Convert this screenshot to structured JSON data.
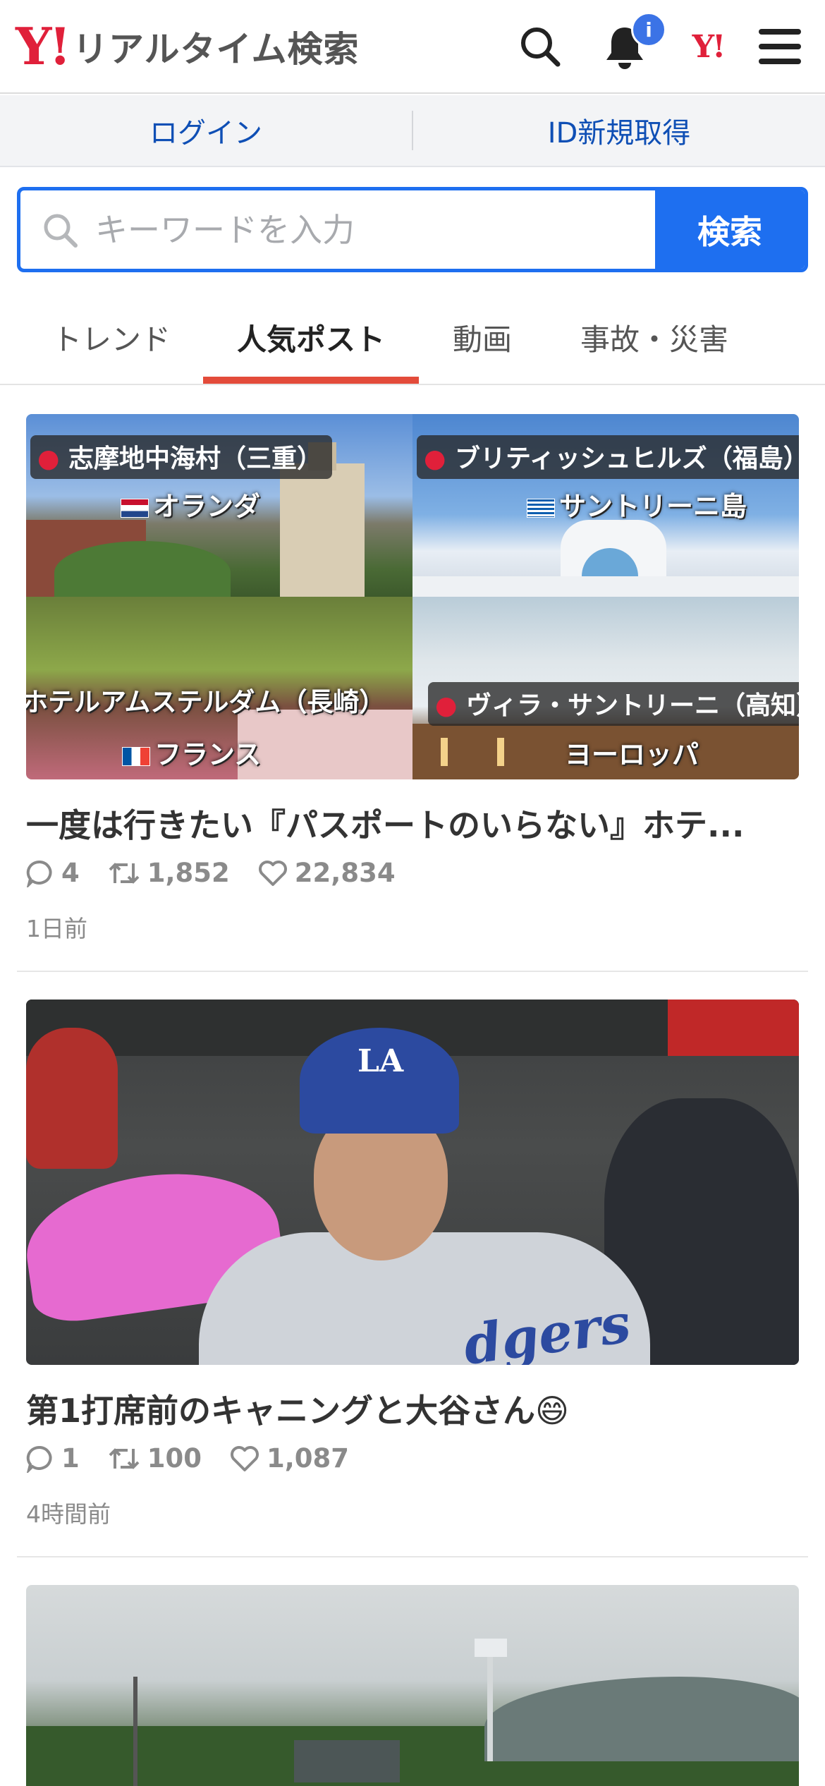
{
  "header": {
    "logo_mark": "Y!",
    "logo_text": "リアルタイム検索",
    "notification_badge": "i",
    "yj_mark": "Y!"
  },
  "auth": {
    "login": "ログイン",
    "register": "ID新規取得"
  },
  "search": {
    "placeholder": "キーワードを入力",
    "button": "検索"
  },
  "tabs": [
    {
      "label": "トレンド",
      "active": false
    },
    {
      "label": "人気ポスト",
      "active": true
    },
    {
      "label": "動画",
      "active": false
    },
    {
      "label": "事故・災害",
      "active": false
    }
  ],
  "posts": [
    {
      "title": "一度は行きたい『パスポートのいらない』ホテ...",
      "replies": "4",
      "reposts": "1,852",
      "likes": "22,834",
      "time": "1日前",
      "image_labels": {
        "tl_place": "志摩地中海村（三重）",
        "tl_country": "オランダ",
        "tr_place": "ブリティッシュヒルズ（福島）",
        "tr_country": "サントリーニ島",
        "bl_place": "ホテルアムステルダム（長崎）",
        "bl_country": "フランス",
        "br_place": "ヴィラ・サントリーニ（高知）",
        "br_country": "ヨーロッパ"
      }
    },
    {
      "title": "第1打席前のキャニングと大谷さん😄",
      "replies": "1",
      "reposts": "100",
      "likes": "1,087",
      "time": "4時間前",
      "image_labels": {
        "cap_logo": "LA",
        "jersey": "dgers"
      }
    }
  ],
  "colors": {
    "brand_red": "#e0203a",
    "link_blue": "#0f4fb5",
    "search_blue": "#1e6ff0",
    "tab_indicator": "#e34b3a"
  }
}
